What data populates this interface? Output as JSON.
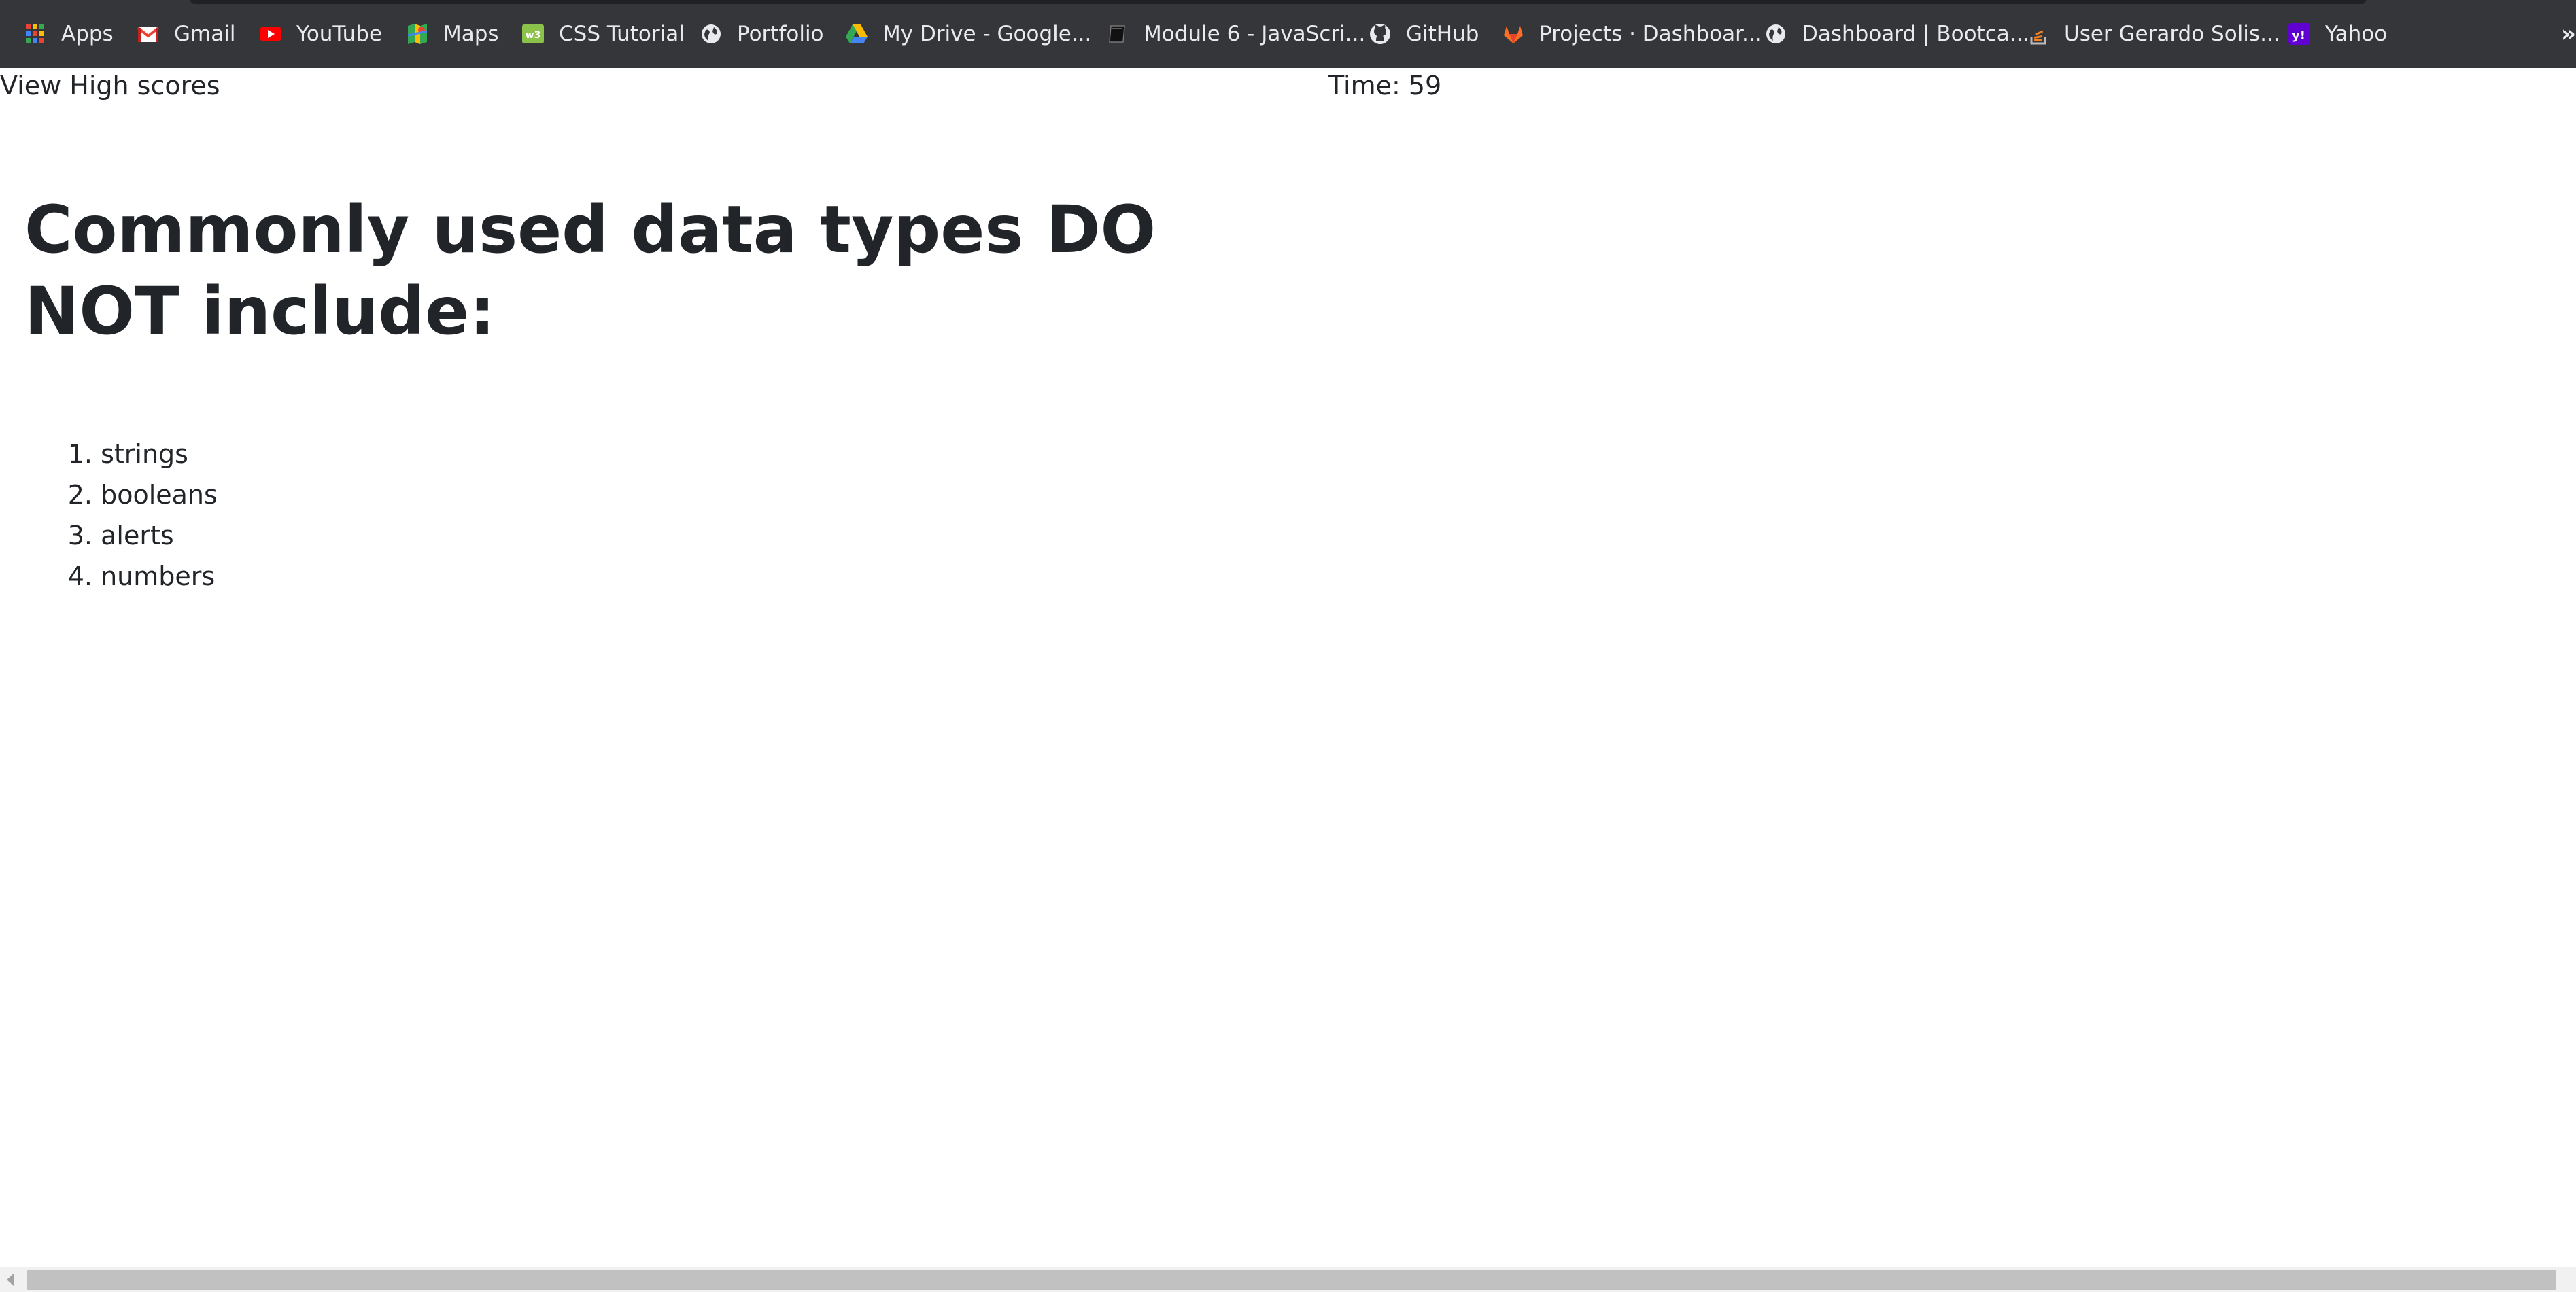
{
  "bookmarks": [
    {
      "label": "Apps",
      "icon": "apps-grid-icon"
    },
    {
      "label": "Gmail",
      "icon": "gmail-icon"
    },
    {
      "label": "YouTube",
      "icon": "youtube-icon"
    },
    {
      "label": "Maps",
      "icon": "maps-icon"
    },
    {
      "label": "CSS Tutorial",
      "icon": "w3schools-icon"
    },
    {
      "label": "Portfolio",
      "icon": "globe-icon"
    },
    {
      "label": "My Drive - Google...",
      "icon": "google-drive-icon"
    },
    {
      "label": "Module 6 - JavaScri...",
      "icon": "book-icon"
    },
    {
      "label": "GitHub",
      "icon": "github-icon"
    },
    {
      "label": "Projects · Dashboar...",
      "icon": "gitlab-icon"
    },
    {
      "label": "Dashboard | Bootca...",
      "icon": "globe-icon"
    },
    {
      "label": "User Gerardo Solis...",
      "icon": "stackoverflow-icon"
    },
    {
      "label": "Yahoo",
      "icon": "yahoo-icon"
    }
  ],
  "more_label": "»",
  "header": {
    "high_scores_link": "View High scores",
    "timer_text": "Time: 59"
  },
  "quiz": {
    "question": "Commonly used data types DO NOT include:",
    "choices": [
      {
        "number": "1.",
        "text": "strings"
      },
      {
        "number": "2.",
        "text": "booleans"
      },
      {
        "number": "3.",
        "text": "alerts"
      },
      {
        "number": "4.",
        "text": "numbers"
      }
    ]
  },
  "colors": {
    "toolbar_bg": "#35363a",
    "toolbar_text": "#e8eaed",
    "page_text": "#212529",
    "page_bg": "#ffffff"
  }
}
